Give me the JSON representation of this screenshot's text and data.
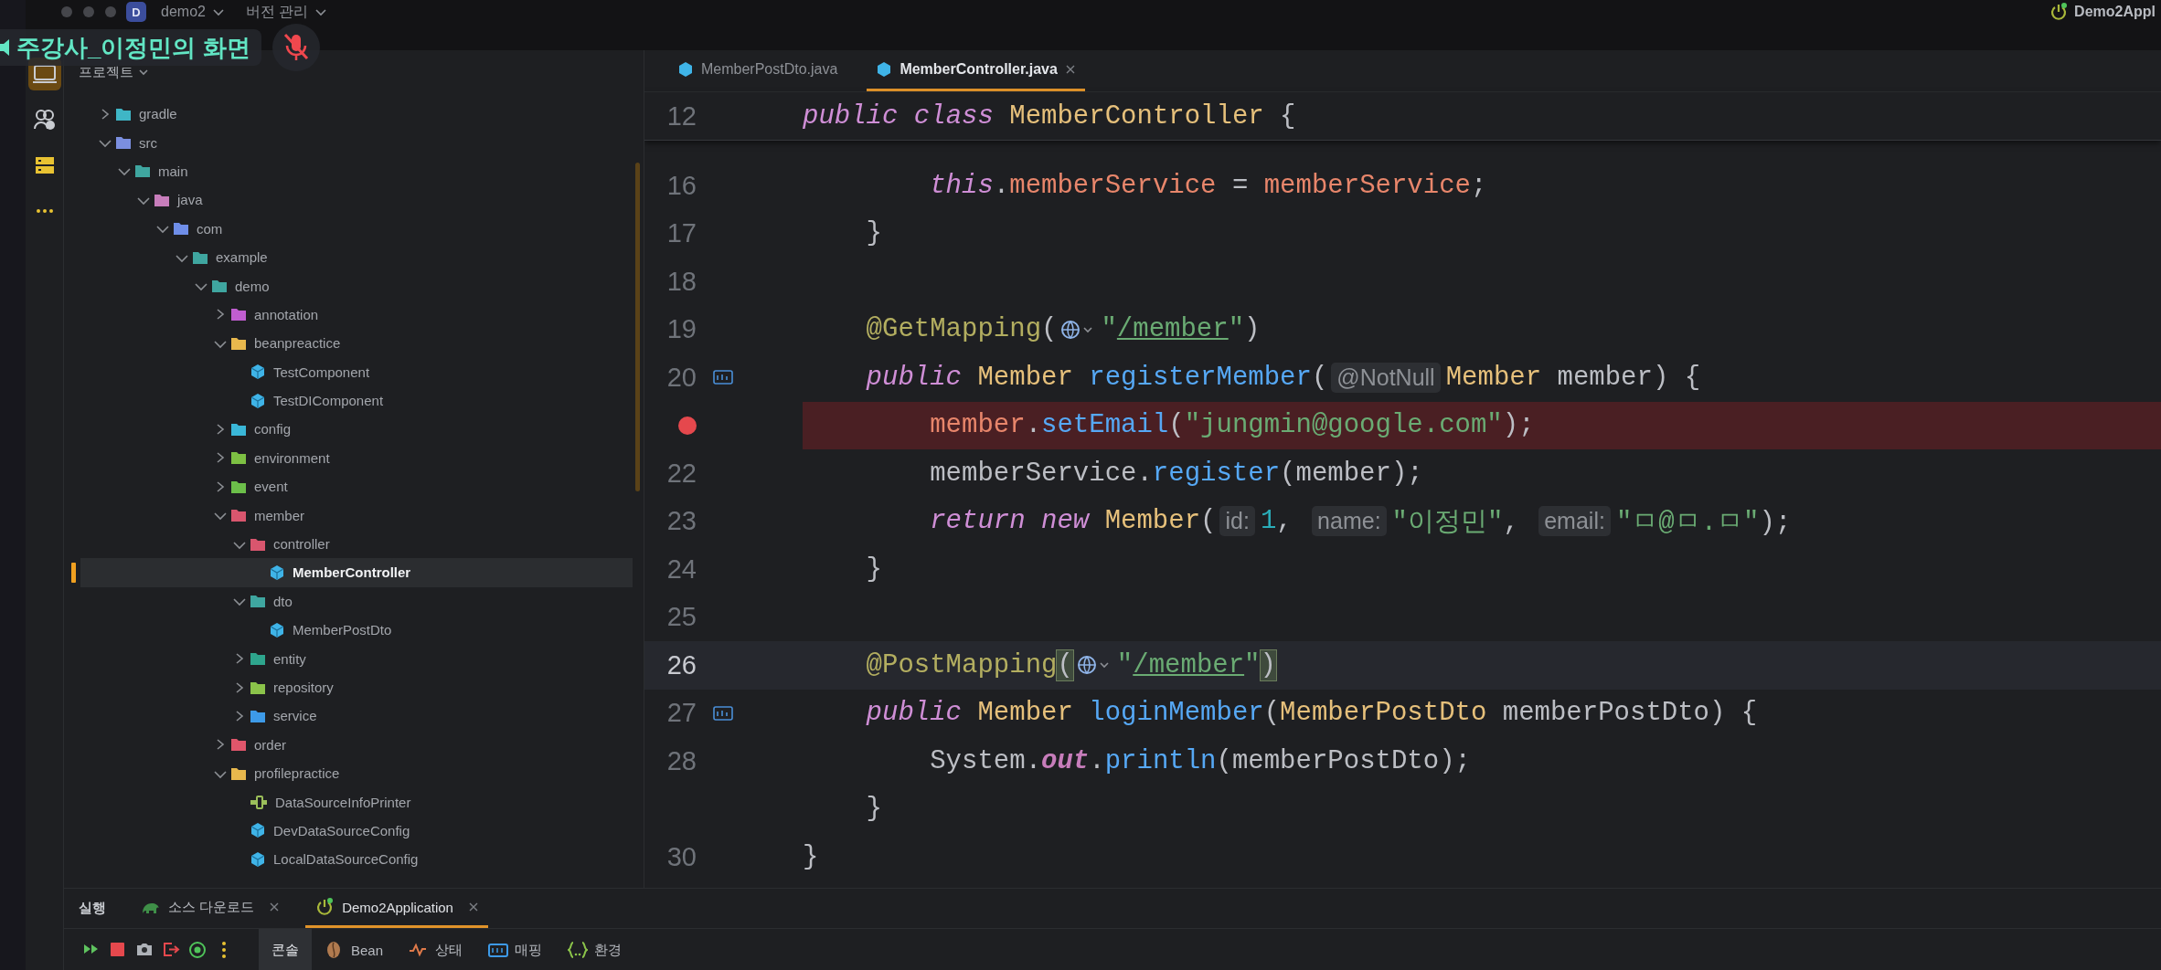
{
  "title_bar": {
    "project": {
      "badge": "D",
      "name": "demo2"
    },
    "vcs": "버전 관리",
    "run_config": "Demo2Appl"
  },
  "screen_share": {
    "label": "주강사_이정민의 화면",
    "muted": true
  },
  "activity_bar": [
    {
      "kind": "project",
      "selected": true
    },
    {
      "kind": "people",
      "selected": false
    },
    {
      "kind": "structure",
      "selected": false
    },
    {
      "kind": "more",
      "selected": false
    }
  ],
  "project": {
    "title": "프로젝트",
    "tree": [
      {
        "label": "gradle",
        "kind": "folder",
        "color": "#3fb6c6",
        "expanded": false,
        "selected": false
      },
      {
        "label": "src",
        "kind": "folder",
        "color": "#7b8fe0",
        "expanded": true,
        "selected": false,
        "children": [
          {
            "label": "main",
            "kind": "folder",
            "color": "#3fa6a0",
            "expanded": true,
            "selected": false,
            "children": [
              {
                "label": "java",
                "kind": "folder",
                "color": "#c77dbb",
                "expanded": true,
                "selected": false,
                "children": [
                  {
                    "label": "com",
                    "kind": "folder",
                    "color": "#6f8ee8",
                    "expanded": true,
                    "selected": false,
                    "children": [
                      {
                        "label": "example",
                        "kind": "folder",
                        "color": "#3fa6a0",
                        "expanded": true,
                        "selected": false,
                        "children": [
                          {
                            "label": "demo",
                            "kind": "folder",
                            "color": "#3fa6a0",
                            "expanded": true,
                            "selected": false,
                            "children": [
                              {
                                "label": "annotation",
                                "kind": "folder",
                                "color": "#c05ed0",
                                "expanded": false,
                                "selected": false
                              },
                              {
                                "label": "beanpreactice",
                                "kind": "folder",
                                "color": "#e8b84d",
                                "expanded": true,
                                "selected": false,
                                "children": [
                                  {
                                    "label": "TestComponent",
                                    "kind": "class",
                                    "selected": false
                                  },
                                  {
                                    "label": "TestDIComponent",
                                    "kind": "class",
                                    "selected": false
                                  }
                                ]
                              },
                              {
                                "label": "config",
                                "kind": "folder",
                                "color": "#3ab7d8",
                                "expanded": false,
                                "selected": false
                              },
                              {
                                "label": "environment",
                                "kind": "folder",
                                "color": "#7dc043",
                                "expanded": false,
                                "selected": false
                              },
                              {
                                "label": "event",
                                "kind": "folder",
                                "color": "#6cbf4a",
                                "expanded": false,
                                "selected": false
                              },
                              {
                                "label": "member",
                                "kind": "folder",
                                "color": "#d9566e",
                                "expanded": true,
                                "selected": false,
                                "children": [
                                  {
                                    "label": "controller",
                                    "kind": "folder",
                                    "color": "#d9566e",
                                    "expanded": true,
                                    "selected": false,
                                    "children": [
                                      {
                                        "label": "MemberController",
                                        "kind": "class",
                                        "selected": true
                                      }
                                    ]
                                  },
                                  {
                                    "label": "dto",
                                    "kind": "folder",
                                    "color": "#3fa6a0",
                                    "expanded": true,
                                    "selected": false,
                                    "children": [
                                      {
                                        "label": "MemberPostDto",
                                        "kind": "class",
                                        "selected": false
                                      }
                                    ]
                                  },
                                  {
                                    "label": "entity",
                                    "kind": "folder",
                                    "color": "#2ea58d",
                                    "expanded": false,
                                    "selected": false
                                  },
                                  {
                                    "label": "repository",
                                    "kind": "folder",
                                    "color": "#8bc34a",
                                    "expanded": false,
                                    "selected": false
                                  },
                                  {
                                    "label": "service",
                                    "kind": "folder",
                                    "color": "#3d9ae8",
                                    "expanded": false,
                                    "selected": false
                                  }
                                ]
                              },
                              {
                                "label": "order",
                                "kind": "folder",
                                "color": "#e0566b",
                                "expanded": false,
                                "selected": false
                              },
                              {
                                "label": "profilepractice",
                                "kind": "folder",
                                "color": "#e8b84d",
                                "expanded": true,
                                "selected": false,
                                "children": [
                                  {
                                    "label": "DataSourceInfoPrinter",
                                    "kind": "component",
                                    "selected": false
                                  },
                                  {
                                    "label": "DevDataSourceConfig",
                                    "kind": "class",
                                    "selected": false
                                  },
                                  {
                                    "label": "LocalDataSourceConfig",
                                    "kind": "class",
                                    "selected": false
                                  }
                                ]
                              }
                            ]
                          }
                        ]
                      }
                    ]
                  }
                ]
              }
            ]
          }
        ]
      }
    ]
  },
  "editor": {
    "tabs": [
      {
        "label": "MemberPostDto.java",
        "selected": false,
        "closable": false
      },
      {
        "label": "MemberController.java",
        "selected": true,
        "closable": true
      }
    ],
    "sticky_line": {
      "number": "12",
      "tokens": [
        {
          "kind": "keyword",
          "t": "public class "
        },
        {
          "kind": "type",
          "t": "MemberController"
        },
        {
          "kind": "plain",
          "t": " {"
        }
      ]
    },
    "lines": [
      {
        "number": "16",
        "kind": "statement",
        "breakpoint": false,
        "current": false,
        "tokens": [
          {
            "kind": "keyword",
            "t": "this"
          },
          {
            "kind": "plain",
            "t": "."
          },
          {
            "kind": "field",
            "t": "memberService"
          },
          {
            "kind": "plain",
            "t": " = "
          },
          {
            "kind": "field",
            "t": "memberService"
          },
          {
            "kind": "plain",
            "t": ";"
          }
        ]
      },
      {
        "number": "17",
        "kind": "member",
        "breakpoint": false,
        "current": false,
        "tokens": [
          {
            "kind": "plain",
            "t": "}"
          }
        ]
      },
      {
        "number": "18",
        "kind": "top",
        "breakpoint": false,
        "current": false
      },
      {
        "number": "19",
        "kind": "member",
        "breakpoint": false,
        "current": false,
        "tokens": [
          {
            "kind": "annotation",
            "t": "@GetMapping"
          },
          {
            "kind": "plain",
            "t": "("
          },
          {
            "kind": "globe"
          },
          {
            "kind": "string",
            "t": "\""
          },
          {
            "kind": "url",
            "t": "/member"
          },
          {
            "kind": "string",
            "t": "\""
          },
          {
            "kind": "plain",
            "t": ")"
          }
        ]
      },
      {
        "number": "20",
        "kind": "member",
        "breakpoint": false,
        "current": false,
        "endpoint": true,
        "tokens": [
          {
            "kind": "keyword",
            "t": "public "
          },
          {
            "kind": "type",
            "t": "Member "
          },
          {
            "kind": "method",
            "t": "registerMember"
          },
          {
            "kind": "plain",
            "t": "("
          },
          {
            "kind": "hint",
            "t": "@NotNull"
          },
          {
            "kind": "type",
            "t": "Member "
          },
          {
            "kind": "plain",
            "t": "member) {"
          }
        ]
      },
      {
        "kind": "statement",
        "breakpoint": true,
        "current": false,
        "tokens": [
          {
            "kind": "field",
            "t": "member"
          },
          {
            "kind": "plain",
            "t": "."
          },
          {
            "kind": "method",
            "t": "setEmail"
          },
          {
            "kind": "plain",
            "t": "("
          },
          {
            "kind": "string",
            "t": "\"jungmin@google.com\""
          },
          {
            "kind": "plain",
            "t": ");"
          }
        ]
      },
      {
        "number": "22",
        "kind": "statement",
        "breakpoint": false,
        "current": false,
        "tokens": [
          {
            "kind": "plain",
            "t": "memberService."
          },
          {
            "kind": "method",
            "t": "register"
          },
          {
            "kind": "plain",
            "t": "(member);"
          }
        ]
      },
      {
        "number": "23",
        "kind": "statement",
        "breakpoint": false,
        "current": false,
        "tokens": [
          {
            "kind": "keyword",
            "t": "return new "
          },
          {
            "kind": "type",
            "t": "Member"
          },
          {
            "kind": "plain",
            "t": "("
          },
          {
            "kind": "hint",
            "t": "id:"
          },
          {
            "kind": "number",
            "t": "1"
          },
          {
            "kind": "plain",
            "t": ", "
          },
          {
            "kind": "hint",
            "t": "name:"
          },
          {
            "kind": "string",
            "t": "\"이정민\""
          },
          {
            "kind": "plain",
            "t": ", "
          },
          {
            "kind": "hint",
            "t": "email:"
          },
          {
            "kind": "string",
            "t": "\"ㅁ@ㅁ.ㅁ\""
          },
          {
            "kind": "plain",
            "t": ");"
          }
        ]
      },
      {
        "number": "24",
        "kind": "member",
        "breakpoint": false,
        "current": false,
        "tokens": [
          {
            "kind": "plain",
            "t": "}"
          }
        ]
      },
      {
        "number": "25",
        "kind": "top",
        "breakpoint": false,
        "current": false
      },
      {
        "number": "26",
        "kind": "member",
        "breakpoint": false,
        "current": true,
        "tokens": [
          {
            "kind": "annotation",
            "t": "@PostMapping"
          },
          {
            "kind": "match",
            "t": "("
          },
          {
            "kind": "globe"
          },
          {
            "kind": "string",
            "t": "\""
          },
          {
            "kind": "url",
            "t": "/member"
          },
          {
            "kind": "string",
            "t": "\""
          },
          {
            "kind": "match",
            "t": ")"
          }
        ]
      },
      {
        "number": "27",
        "kind": "member",
        "breakpoint": false,
        "current": false,
        "endpoint": true,
        "tokens": [
          {
            "kind": "keyword",
            "t": "public "
          },
          {
            "kind": "type",
            "t": "Member "
          },
          {
            "kind": "method",
            "t": "loginMember"
          },
          {
            "kind": "plain",
            "t": "("
          },
          {
            "kind": "type",
            "t": "MemberPostDto "
          },
          {
            "kind": "plain",
            "t": "memberPostDto) {"
          }
        ]
      },
      {
        "number": "28",
        "kind": "statement",
        "breakpoint": false,
        "current": false,
        "tokens": [
          {
            "kind": "plain",
            "t": "System."
          },
          {
            "kind": "static",
            "t": "out"
          },
          {
            "kind": "plain",
            "t": "."
          },
          {
            "kind": "method",
            "t": "println"
          },
          {
            "kind": "plain",
            "t": "(memberPostDto);"
          }
        ]
      },
      {
        "kind": "member",
        "breakpoint": false,
        "current": false,
        "tokens": [
          {
            "kind": "plain",
            "t": "}"
          }
        ]
      },
      {
        "number": "30",
        "kind": "top",
        "breakpoint": false,
        "current": false,
        "tokens": [
          {
            "kind": "plain",
            "t": "}"
          }
        ]
      }
    ]
  },
  "run_panel": {
    "title": "실행",
    "tabs": [
      {
        "kind": "gradle",
        "label": "소스 다운로드",
        "selected": false,
        "closable": true
      },
      {
        "kind": "app",
        "label": "Demo2Application",
        "selected": true,
        "closable": true
      }
    ],
    "toolbar": [
      {
        "kind": "rerun"
      },
      {
        "kind": "stop"
      },
      {
        "kind": "camera"
      },
      {
        "kind": "exit"
      },
      {
        "kind": "status"
      },
      {
        "kind": "more"
      }
    ],
    "views": [
      {
        "kind": "console",
        "label": "콘솔",
        "selected": true
      },
      {
        "kind": "bean",
        "label": "Bean",
        "selected": false
      },
      {
        "kind": "health",
        "label": "상태",
        "selected": false
      },
      {
        "kind": "mapping",
        "label": "매핑",
        "selected": false
      },
      {
        "kind": "env",
        "label": "환경",
        "selected": false
      }
    ]
  }
}
